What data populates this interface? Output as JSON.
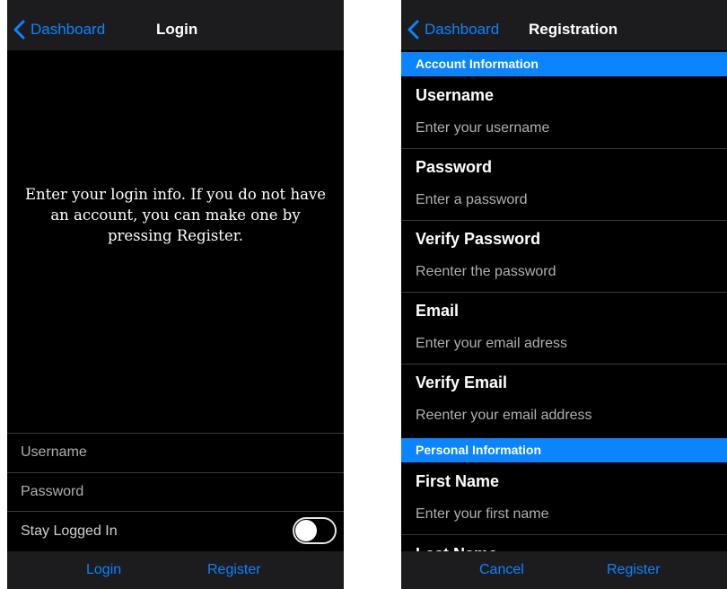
{
  "login_screen": {
    "nav": {
      "back_label": "Dashboard",
      "title": "Login"
    },
    "message": "Enter your login info. If you do not have an account, you can make one by pressing Register.",
    "fields": {
      "username_placeholder": "Username",
      "password_placeholder": "Password"
    },
    "stay_logged_in": {
      "label": "Stay Logged In",
      "on": false
    },
    "tabbar": {
      "login_label": "Login",
      "register_label": "Register"
    }
  },
  "registration_screen": {
    "nav": {
      "back_label": "Dashboard",
      "title": "Registration"
    },
    "sections": [
      {
        "header": "Account Information",
        "fields": [
          {
            "label": "Username",
            "placeholder": "Enter your username"
          },
          {
            "label": "Password",
            "placeholder": "Enter a password"
          },
          {
            "label": "Verify Password",
            "placeholder": "Reenter the password"
          },
          {
            "label": "Email",
            "placeholder": "Enter your email adress"
          },
          {
            "label": "Verify Email",
            "placeholder": "Reenter your email address"
          }
        ]
      },
      {
        "header": "Personal Information",
        "fields": [
          {
            "label": "First Name",
            "placeholder": "Enter your first name"
          },
          {
            "label": "Last Name",
            "placeholder": ""
          }
        ]
      }
    ],
    "tabbar": {
      "cancel_label": "Cancel",
      "register_label": "Register"
    }
  },
  "colors": {
    "accent": "#0a84ff",
    "background": "#000000",
    "bar": "#1c1c1e",
    "separator": "#3a3a3c"
  },
  "icons": {
    "back": "chevron-left-icon"
  }
}
